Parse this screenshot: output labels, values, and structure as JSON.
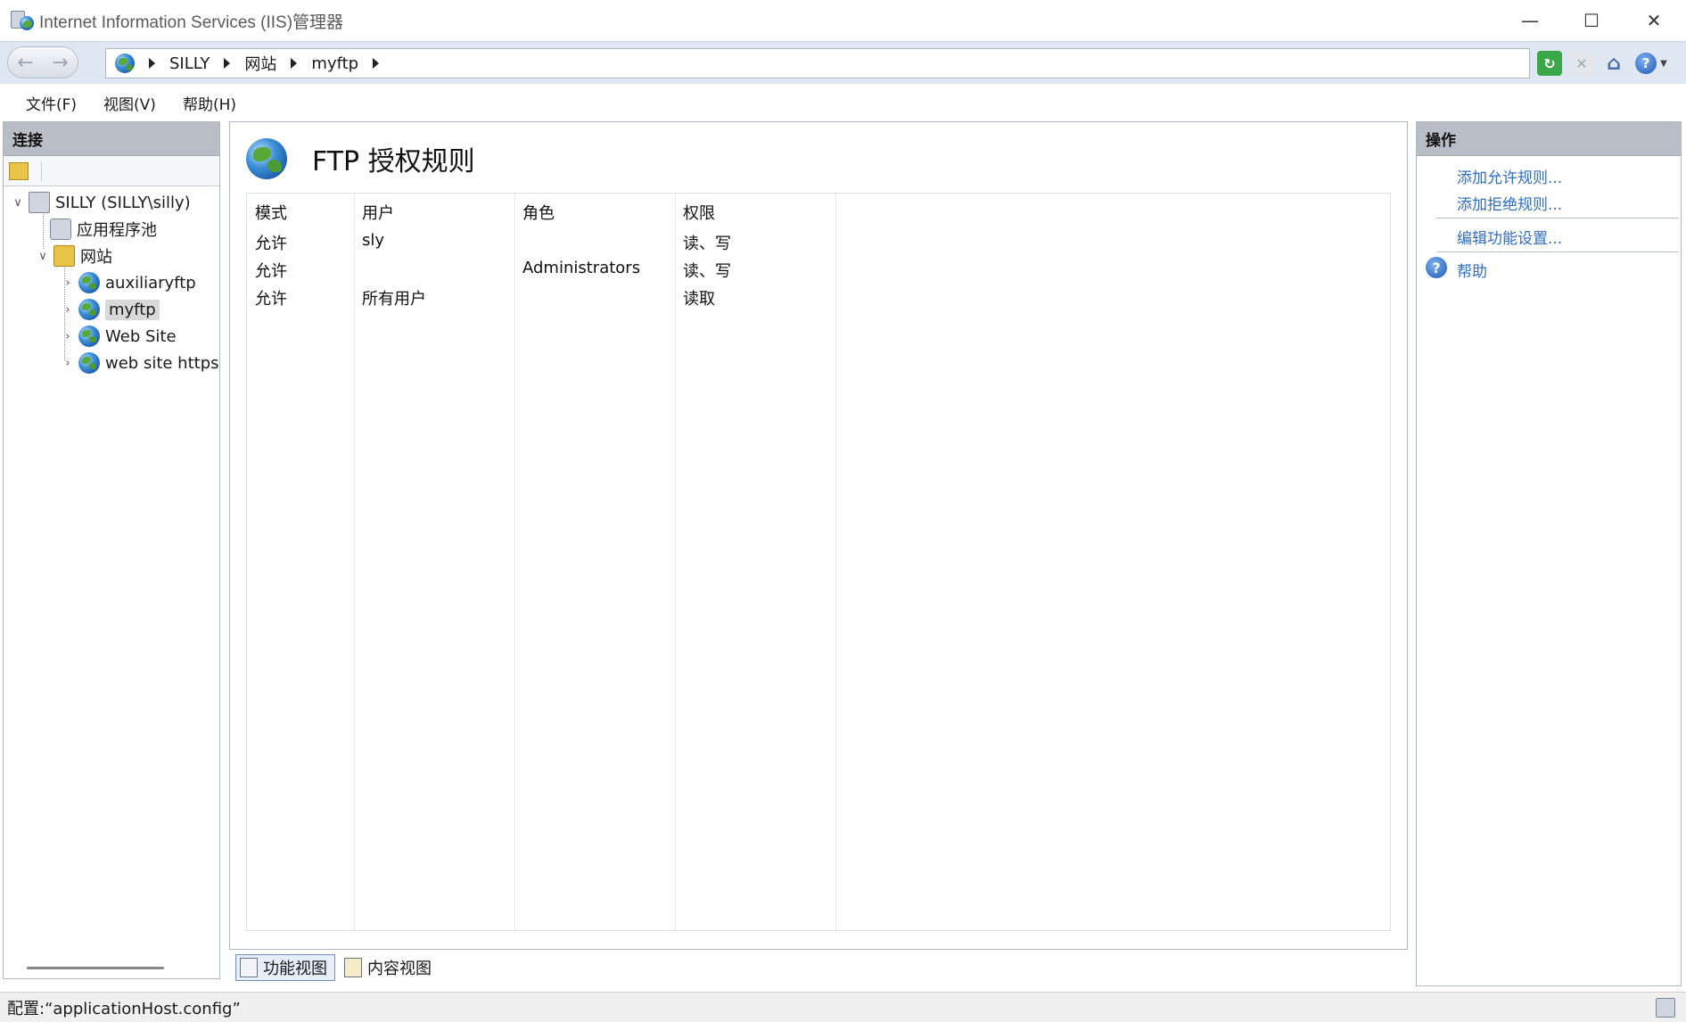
{
  "window": {
    "title": "Internet Information Services (IIS)管理器",
    "minimize_icon": "minimize-icon",
    "maximize_icon": "maximize-icon",
    "close_icon": "close-icon"
  },
  "address": {
    "crumbs": [
      "SILLY",
      "网站",
      "myftp"
    ]
  },
  "menu": {
    "items": [
      "文件(F)",
      "视图(V)",
      "帮助(H)"
    ]
  },
  "connections": {
    "header": "连接",
    "tree": [
      {
        "label": "SILLY (SILLY\\silly)",
        "icon": "server-icon",
        "expanded": true
      },
      {
        "label": "应用程序池",
        "icon": "app-pool-icon"
      },
      {
        "label": "网站",
        "icon": "sites-folder-icon",
        "expanded": true
      },
      {
        "label": "auxiliaryftp",
        "icon": "globe-icon"
      },
      {
        "label": "myftp",
        "icon": "globe-icon",
        "selected": true
      },
      {
        "label": "Web Site",
        "icon": "globe-icon"
      },
      {
        "label": "web site https",
        "icon": "globe-icon"
      }
    ]
  },
  "feature": {
    "title": "FTP 授权规则",
    "columns": [
      "模式",
      "用户",
      "角色",
      "权限"
    ],
    "rows": [
      {
        "mode": "允许",
        "user": "sly",
        "role": "",
        "perm": "读、写"
      },
      {
        "mode": "允许",
        "user": "",
        "role": "Administrators",
        "perm": "读、写"
      },
      {
        "mode": "允许",
        "user": "所有用户",
        "role": "",
        "perm": "读取"
      }
    ]
  },
  "views": {
    "feature_view": "功能视图",
    "content_view": "内容视图"
  },
  "actions": {
    "header": "操作",
    "add_allow": "添加允许规则...",
    "add_deny": "添加拒绝规则...",
    "edit_settings": "编辑功能设置...",
    "help": "帮助"
  },
  "status": {
    "text": "配置:“applicationHost.config”"
  },
  "colors": {
    "accent_link": "#2f6fc2",
    "panel_header": "#b9bec6",
    "address_bar": "#dfe7f2"
  }
}
